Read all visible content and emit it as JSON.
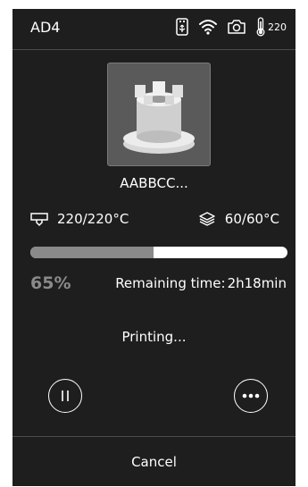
{
  "status_bar": {
    "device_name": "AD4",
    "icons": [
      "usb-icon",
      "wifi-icon",
      "camera-icon",
      "thermometer-icon"
    ],
    "chamber_temp": "220"
  },
  "job": {
    "file_name": "AABBCC...",
    "thumbnail": "castle-nut-model-thumbnail"
  },
  "temps": {
    "nozzle": "220/220°C",
    "bed": "60/60°C"
  },
  "progress": {
    "fraction": 0.48,
    "percent_label": "65%",
    "remaining_label": "Remaining time:",
    "remaining_value": "2h18min"
  },
  "status_text": "Printing...",
  "controls": {
    "pause_icon": "pause-icon",
    "more_icon": "more-icon",
    "cancel_label": "Cancel"
  },
  "colors": {
    "screen_bg": "#1e1e1e",
    "progress_fill": "#8a8a8a",
    "progress_track": "#ffffff",
    "percent_text": "#8a8a8a"
  }
}
